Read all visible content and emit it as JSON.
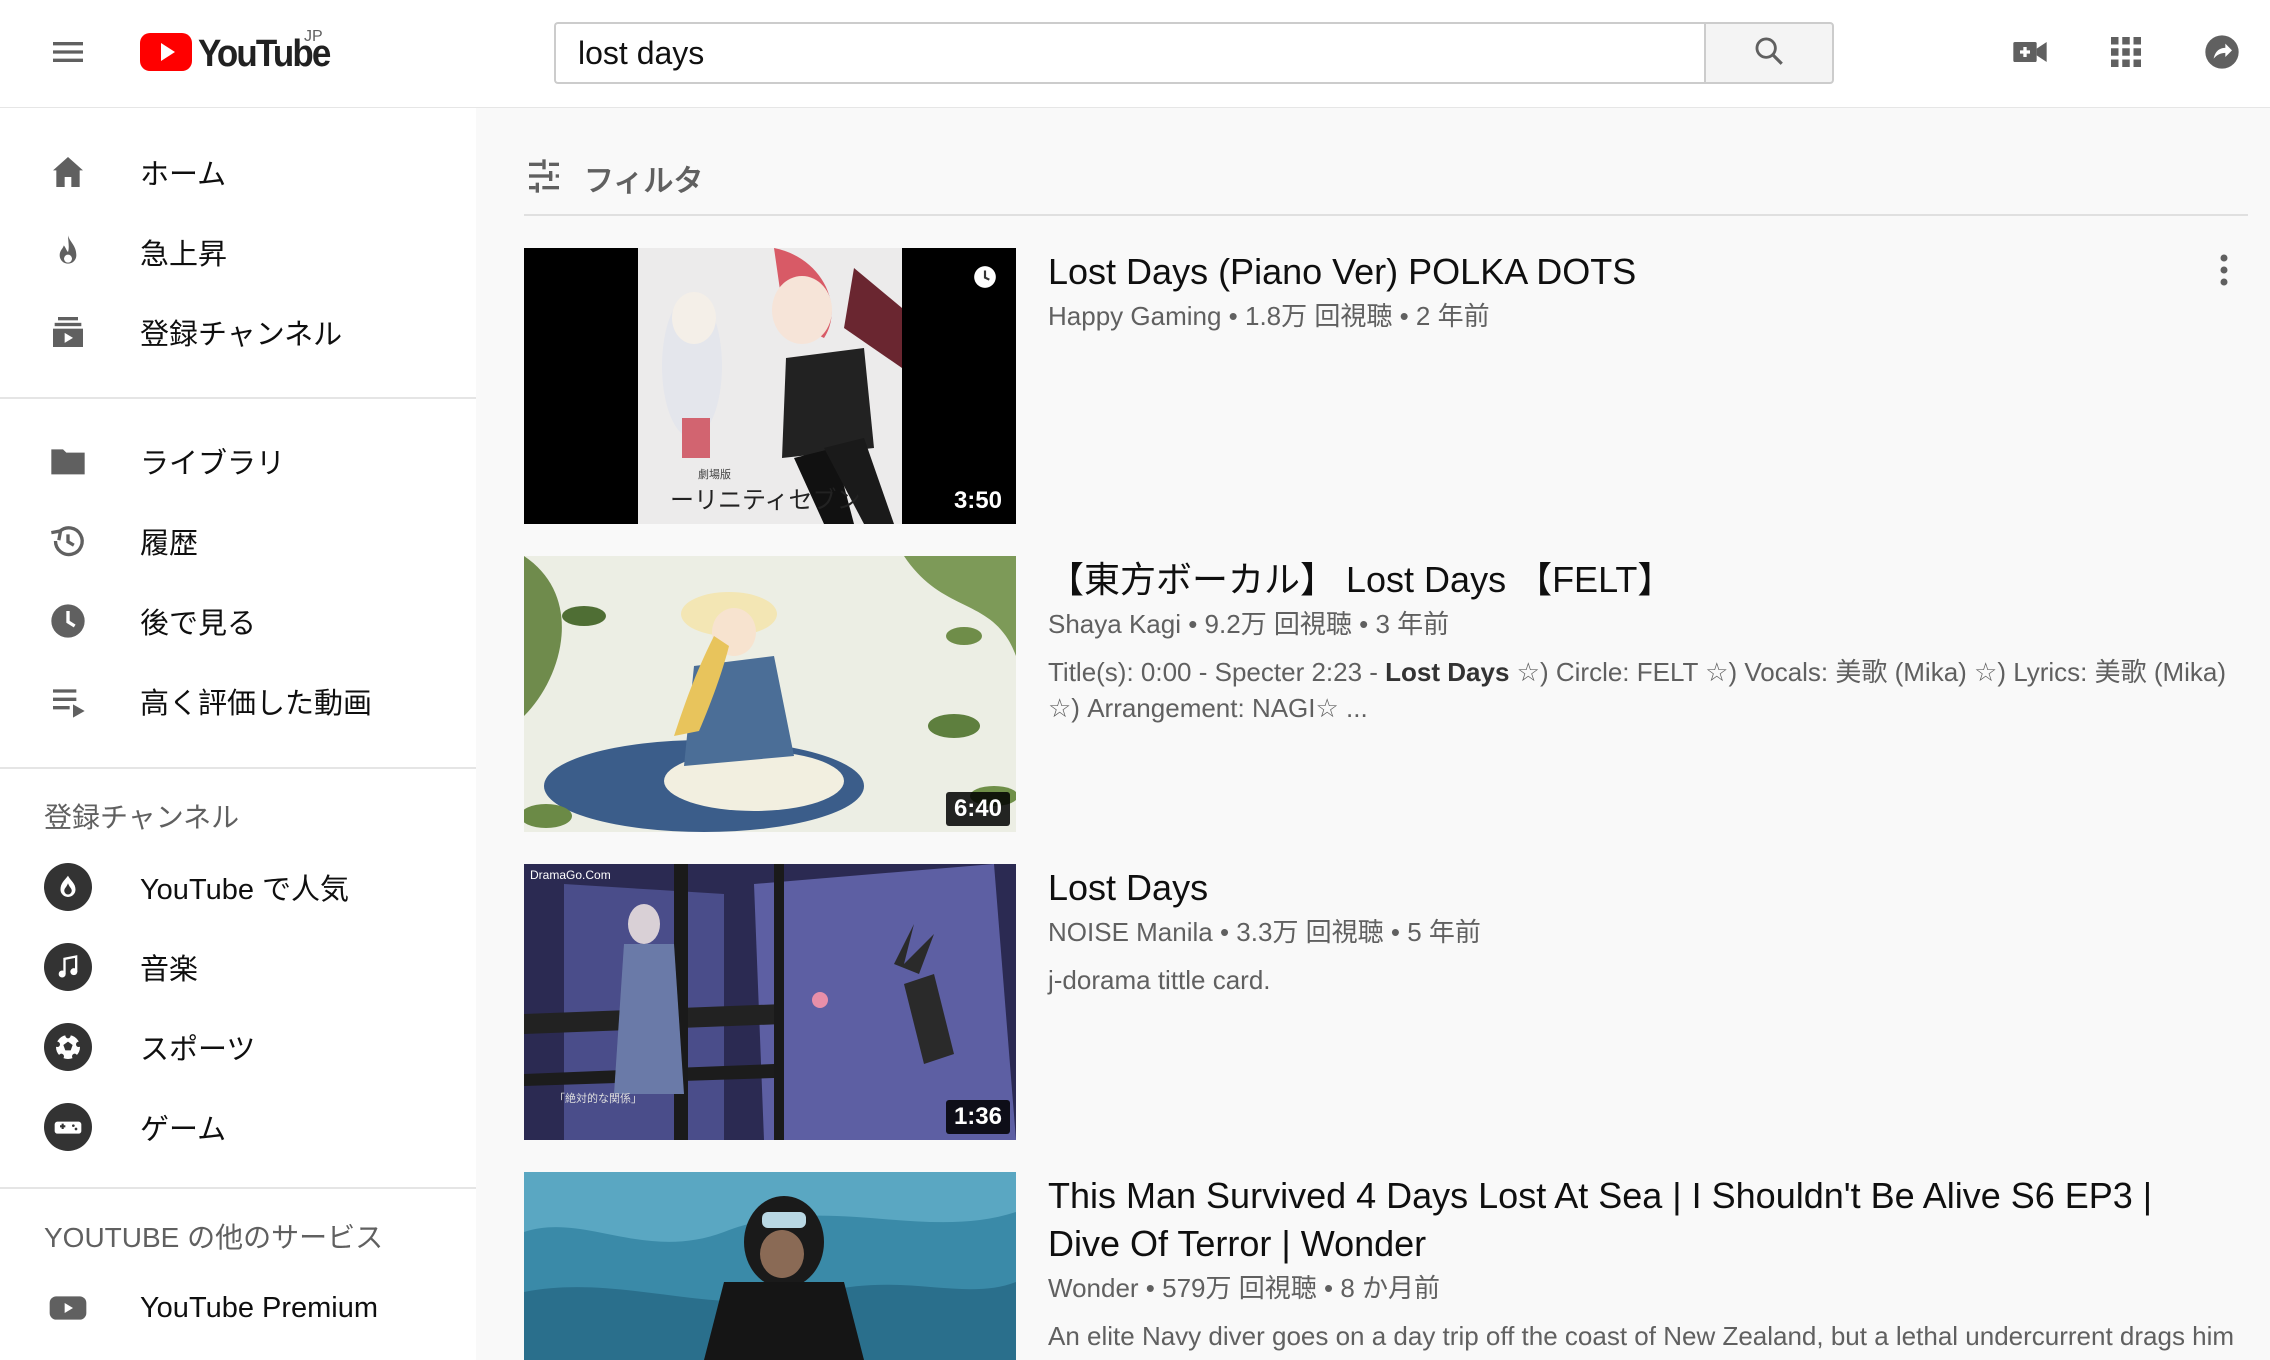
{
  "header": {
    "logo_text": "YouTube",
    "logo_region": "JP",
    "search_value": "lost days"
  },
  "sidebar": {
    "primary": [
      {
        "label": "ホーム",
        "icon": "home-icon"
      },
      {
        "label": "急上昇",
        "icon": "trending-icon"
      },
      {
        "label": "登録チャンネル",
        "icon": "subscriptions-icon"
      }
    ],
    "library": [
      {
        "label": "ライブラリ",
        "icon": "library-folder-icon"
      },
      {
        "label": "履歴",
        "icon": "history-icon"
      },
      {
        "label": "後で見る",
        "icon": "watch-later-icon"
      },
      {
        "label": "高く評価した動画",
        "icon": "liked-videos-icon"
      }
    ],
    "subscriptions_title": "登録チャンネル",
    "subscriptions": [
      {
        "label": "YouTube で人気",
        "icon": "popular-icon"
      },
      {
        "label": "音楽",
        "icon": "music-icon"
      },
      {
        "label": "スポーツ",
        "icon": "sports-icon"
      },
      {
        "label": "ゲーム",
        "icon": "gaming-icon"
      }
    ],
    "more_title": "YOUTUBE の他のサービス",
    "more": [
      {
        "label": "YouTube Premium",
        "icon": "youtube-premium-icon"
      }
    ]
  },
  "filter": {
    "label": "フィルタ"
  },
  "results": [
    {
      "title": "Lost Days (Piano Ver) POLKA DOTS",
      "channel": "Happy Gaming",
      "views": "1.8万 回視聴",
      "age": "2 年前",
      "duration": "3:50",
      "thumb_text": "ーリニティセブン",
      "thumb_small": "劇場版"
    },
    {
      "title": "【東方ボーカル】 Lost Days 【FELT】",
      "channel": "Shaya Kagi",
      "views": "9.2万 回視聴",
      "age": "3 年前",
      "duration": "6:40",
      "desc_pre": "Title(s): 0:00 - Specter 2:23 - ",
      "desc_bold": "Lost Days",
      "desc_post": " ☆) Circle: FELT ☆) Vocals: 美歌 (Mika) ☆) Lyrics: 美歌 (Mika) ☆) Arrangement: NAGI☆ ..."
    },
    {
      "title": "Lost Days",
      "channel": "NOISE Manila",
      "views": "3.3万 回視聴",
      "age": "5 年前",
      "duration": "1:36",
      "description": "j-dorama tittle card.",
      "thumb_watermark": "DramaGo.Com",
      "thumb_caption": "「絶対的な関係」"
    },
    {
      "title": "This Man Survived 4 Days Lost At Sea | I Shouldn't Be Alive S6 EP3 | Dive Of Terror | Wonder",
      "channel": "Wonder",
      "views": "579万 回視聴",
      "age": "8 か月前",
      "description": "An elite Navy diver goes on a day trip off the coast of New Zealand, but a lethal undercurrent drags him"
    }
  ],
  "colors": {
    "brand_red": "#ff0000",
    "text_secondary": "#606060"
  }
}
